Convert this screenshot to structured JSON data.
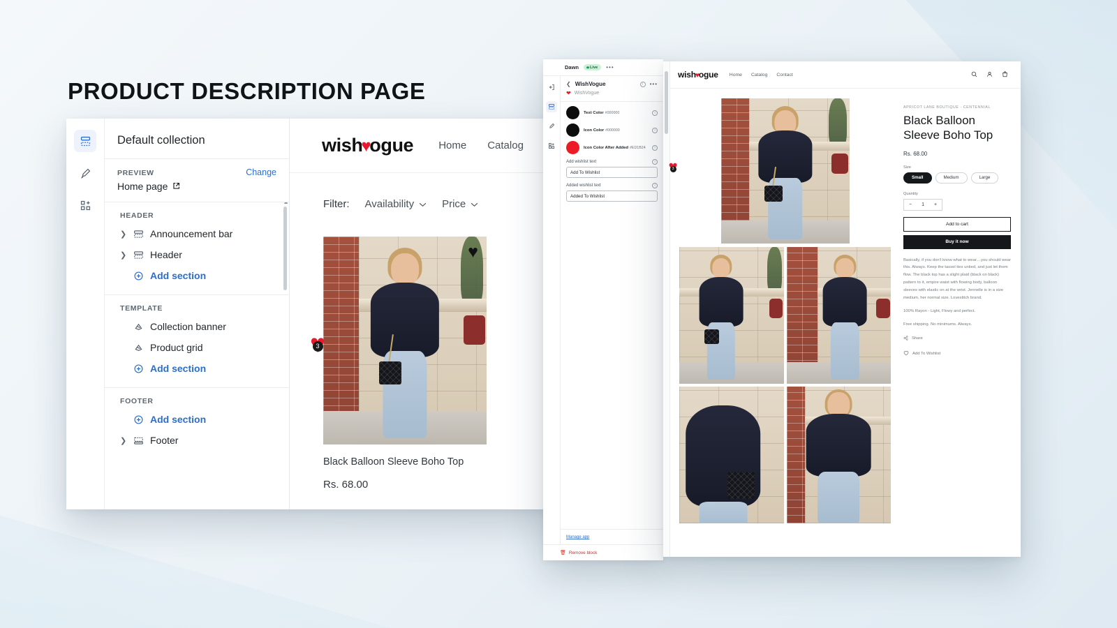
{
  "slide": {
    "title": "PRODUCT DESCRIPTION PAGE"
  },
  "editor": {
    "rail": [
      {
        "name": "sections-icon",
        "glyph": "▤"
      },
      {
        "name": "paint-brush-icon",
        "glyph": "✎"
      },
      {
        "name": "apps-icon",
        "glyph": "⊞"
      }
    ],
    "panel_title": "Default collection",
    "preview_label": "PREVIEW",
    "change_label": "Change",
    "preview_page": "Home page",
    "groups": [
      {
        "title": "HEADER",
        "items": [
          {
            "label": "Announcement bar",
            "expandable": true,
            "icon": "section-icon",
            "type": "section"
          },
          {
            "label": "Header",
            "expandable": true,
            "icon": "section-icon",
            "type": "section"
          },
          {
            "label": "Add section",
            "expandable": false,
            "icon": "plus-circle-icon",
            "type": "add"
          }
        ]
      },
      {
        "title": "TEMPLATE",
        "items": [
          {
            "label": "Collection banner",
            "expandable": false,
            "icon": "block-icon",
            "type": "section"
          },
          {
            "label": "Product grid",
            "expandable": false,
            "icon": "block-icon",
            "type": "section"
          },
          {
            "label": "Add section",
            "expandable": false,
            "icon": "plus-circle-icon",
            "type": "add"
          }
        ]
      },
      {
        "title": "FOOTER",
        "items": [
          {
            "label": "Add section",
            "expandable": false,
            "icon": "plus-circle-icon",
            "type": "add"
          },
          {
            "label": "Footer",
            "expandable": true,
            "icon": "footer-icon",
            "type": "section"
          }
        ]
      }
    ]
  },
  "storefront": {
    "logo": {
      "before": "wish",
      "heart": "♥",
      "after": "ogue"
    },
    "nav": [
      "Home",
      "Catalog",
      "Contact"
    ],
    "filter_label": "Filter:",
    "filters": [
      "Availability",
      "Price"
    ],
    "product": {
      "title": "Black Balloon Sleeve Boho Top",
      "price": "Rs. 68.00",
      "wishlist_count": "3"
    }
  },
  "app_panel": {
    "theme_name": "Dawn",
    "status": "Live",
    "more_label": "•••",
    "app_title": "WishVogue",
    "app_block_name": "WishVogue",
    "colors": [
      {
        "name": "Text Color",
        "hex": "#000000",
        "swatch": "#0d0d0d"
      },
      {
        "name": "Icon Color",
        "hex": "#000000",
        "swatch": "#0d0d0d"
      },
      {
        "name": "Icon Color After Added",
        "hex": "#ED1B24",
        "swatch": "#ED1B24"
      }
    ],
    "fields": [
      {
        "label": "Add wishlist text",
        "value": "Add To Wishlist"
      },
      {
        "label": "Added wishlist text",
        "value": "Added To Wishlist"
      }
    ],
    "manage_app": "Manage app",
    "remove_block": "Remove block"
  },
  "pdp": {
    "logo": {
      "before": "wish",
      "heart": "♥",
      "after": "ogue"
    },
    "nav": [
      "Home",
      "Catalog",
      "Contact"
    ],
    "icons": [
      "search-icon",
      "account-icon",
      "cart-icon"
    ],
    "vendor": "APRICOT LANE BOUTIQUE - CENTENNIAL",
    "title": "Black Balloon Sleeve Boho Top",
    "price": "Rs. 68.00",
    "size_label": "Size",
    "sizes": [
      "Small",
      "Medium",
      "Large"
    ],
    "selected_size": "Small",
    "quantity_label": "Quantity",
    "quantity_value": "1",
    "minus": "−",
    "plus": "+",
    "add_to_cart": "Add to cart",
    "buy_it_now": "Buy it now",
    "description": [
      "Basically, if you don't know what to wear....you should wear this. Always. Keep the tassel ties untied, and just let them flow. The black top has a slight plaid (black on black) pattern to it, empire waist with flowing body, balloon sleeves with elastic on at the wrist. Jennelle is in a size medium, her normal size. Lovestitch brand.",
      "100% Rayon - Light, Flowy and perfect.",
      "Free shipping. No minimums. Always."
    ],
    "share_label": "Share",
    "wishlist_label": "Add To Wishlist",
    "wishlist_badge_count": "3"
  }
}
